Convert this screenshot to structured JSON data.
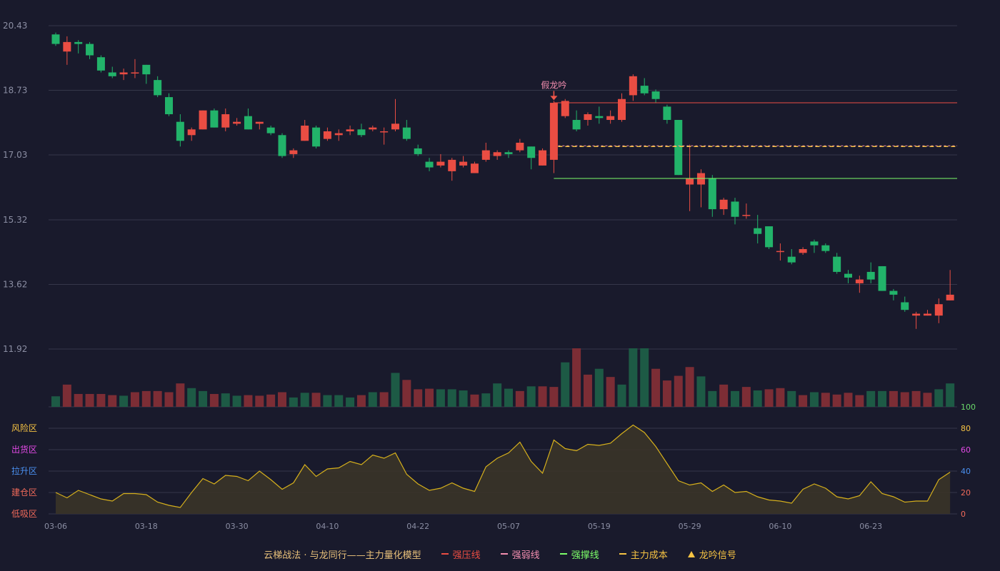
{
  "chart_data": {
    "type": "candlestick",
    "price_axis": {
      "ticks": [
        20.43,
        18.73,
        17.03,
        15.32,
        13.62,
        11.92
      ],
      "range": [
        11.92,
        20.43
      ]
    },
    "x_tick_labels": [
      {
        "i": 0,
        "label": "03-06"
      },
      {
        "i": 8,
        "label": "03-18"
      },
      {
        "i": 16,
        "label": "03-30"
      },
      {
        "i": 24,
        "label": "04-10"
      },
      {
        "i": 32,
        "label": "04-22"
      },
      {
        "i": 40,
        "label": "05-07"
      },
      {
        "i": 48,
        "label": "05-19"
      },
      {
        "i": 56,
        "label": "05-29"
      },
      {
        "i": 64,
        "label": "06-10"
      },
      {
        "i": 72,
        "label": "06-23"
      }
    ],
    "candles": [
      [
        20.2,
        19.95,
        20.25,
        19.9
      ],
      [
        19.75,
        20.0,
        20.15,
        19.4
      ],
      [
        20.0,
        19.95,
        20.05,
        19.7
      ],
      [
        19.95,
        19.65,
        20.0,
        19.55
      ],
      [
        19.6,
        19.25,
        19.65,
        19.2
      ],
      [
        19.2,
        19.1,
        19.35,
        19.05
      ],
      [
        19.15,
        19.2,
        19.3,
        19.0
      ],
      [
        19.2,
        19.2,
        19.55,
        19.05
      ],
      [
        19.4,
        19.15,
        19.4,
        18.9
      ],
      [
        19.0,
        18.6,
        19.1,
        18.55
      ],
      [
        18.55,
        18.1,
        18.65,
        18.05
      ],
      [
        17.9,
        17.4,
        18.1,
        17.25
      ],
      [
        17.55,
        17.7,
        17.75,
        17.4
      ],
      [
        17.7,
        18.2,
        18.2,
        17.7
      ],
      [
        18.2,
        17.75,
        18.25,
        17.75
      ],
      [
        17.75,
        18.1,
        18.25,
        17.65
      ],
      [
        17.85,
        17.9,
        18.0,
        17.8
      ],
      [
        18.05,
        17.7,
        18.25,
        17.7
      ],
      [
        17.85,
        17.9,
        17.9,
        17.7
      ],
      [
        17.75,
        17.6,
        17.8,
        17.55
      ],
      [
        17.55,
        17.0,
        17.6,
        16.95
      ],
      [
        17.05,
        17.15,
        17.2,
        16.95
      ],
      [
        17.4,
        17.8,
        17.95,
        17.4
      ],
      [
        17.75,
        17.25,
        17.8,
        17.2
      ],
      [
        17.45,
        17.65,
        17.75,
        17.4
      ],
      [
        17.55,
        17.6,
        17.7,
        17.4
      ],
      [
        17.65,
        17.7,
        17.8,
        17.55
      ],
      [
        17.7,
        17.55,
        17.85,
        17.5
      ],
      [
        17.7,
        17.75,
        17.8,
        17.65
      ],
      [
        17.65,
        17.65,
        17.75,
        17.3
      ],
      [
        17.7,
        17.85,
        18.5,
        17.65
      ],
      [
        17.75,
        17.45,
        17.95,
        17.4
      ],
      [
        17.2,
        17.05,
        17.3,
        17.0
      ],
      [
        16.85,
        16.7,
        16.95,
        16.6
      ],
      [
        16.75,
        16.85,
        17.05,
        16.7
      ],
      [
        16.6,
        16.9,
        16.95,
        16.35
      ],
      [
        16.75,
        16.85,
        17.0,
        16.7
      ],
      [
        16.55,
        16.8,
        16.85,
        16.55
      ],
      [
        16.9,
        17.15,
        17.35,
        16.85
      ],
      [
        17.0,
        17.1,
        17.15,
        16.9
      ],
      [
        17.1,
        17.05,
        17.15,
        16.95
      ],
      [
        17.15,
        17.35,
        17.45,
        17.1
      ],
      [
        17.25,
        16.95,
        17.25,
        16.65
      ],
      [
        16.75,
        17.15,
        17.2,
        16.75
      ],
      [
        16.9,
        18.4,
        18.45,
        16.55
      ],
      [
        18.05,
        18.45,
        18.5,
        18.0
      ],
      [
        17.95,
        17.7,
        18.2,
        17.65
      ],
      [
        17.95,
        18.1,
        18.15,
        17.8
      ],
      [
        18.05,
        18.0,
        18.3,
        17.85
      ],
      [
        17.95,
        18.05,
        18.2,
        17.85
      ],
      [
        17.95,
        18.5,
        18.65,
        17.9
      ],
      [
        18.6,
        19.1,
        19.15,
        18.45
      ],
      [
        18.85,
        18.65,
        19.05,
        18.6
      ],
      [
        18.7,
        18.5,
        18.75,
        18.4
      ],
      [
        18.3,
        17.95,
        18.35,
        17.85
      ],
      [
        17.95,
        16.5,
        17.95,
        16.5
      ],
      [
        16.25,
        16.4,
        17.3,
        15.55
      ],
      [
        16.25,
        16.55,
        16.65,
        15.65
      ],
      [
        16.4,
        15.6,
        16.5,
        15.4
      ],
      [
        15.6,
        15.85,
        15.9,
        15.45
      ],
      [
        15.8,
        15.4,
        15.9,
        15.2
      ],
      [
        15.45,
        15.45,
        15.75,
        15.35
      ],
      [
        15.1,
        14.95,
        15.45,
        14.7
      ],
      [
        15.15,
        14.6,
        15.15,
        14.55
      ],
      [
        14.5,
        14.5,
        14.7,
        14.25
      ],
      [
        14.35,
        14.2,
        14.55,
        14.15
      ],
      [
        14.45,
        14.55,
        14.6,
        14.4
      ],
      [
        14.75,
        14.65,
        14.8,
        14.45
      ],
      [
        14.65,
        14.5,
        14.7,
        14.45
      ],
      [
        14.35,
        13.95,
        14.45,
        13.9
      ],
      [
        13.9,
        13.8,
        14.0,
        13.65
      ],
      [
        13.65,
        13.75,
        13.85,
        13.4
      ],
      [
        13.95,
        13.75,
        14.2,
        13.65
      ],
      [
        14.1,
        13.45,
        14.1,
        13.45
      ],
      [
        13.45,
        13.35,
        13.5,
        13.2
      ],
      [
        13.15,
        12.95,
        13.3,
        12.9
      ],
      [
        12.8,
        12.85,
        12.9,
        12.45
      ],
      [
        12.8,
        12.85,
        12.95,
        12.8
      ],
      [
        12.8,
        13.1,
        13.25,
        12.6
      ],
      [
        13.2,
        13.35,
        14.0,
        13.2
      ]
    ],
    "volume": [
      [
        "down",
        18
      ],
      [
        "up",
        38
      ],
      [
        "up",
        22
      ],
      [
        "up",
        22
      ],
      [
        "up",
        22
      ],
      [
        "up",
        20
      ],
      [
        "down",
        19
      ],
      [
        "up",
        25
      ],
      [
        "up",
        27
      ],
      [
        "up",
        27
      ],
      [
        "up",
        25
      ],
      [
        "up",
        40
      ],
      [
        "down",
        32
      ],
      [
        "down",
        27
      ],
      [
        "up",
        22
      ],
      [
        "down",
        23
      ],
      [
        "down",
        19
      ],
      [
        "up",
        20
      ],
      [
        "up",
        19
      ],
      [
        "up",
        21
      ],
      [
        "up",
        25
      ],
      [
        "down",
        16
      ],
      [
        "down",
        24
      ],
      [
        "up",
        24
      ],
      [
        "down",
        20
      ],
      [
        "down",
        20
      ],
      [
        "down",
        16
      ],
      [
        "up",
        20
      ],
      [
        "down",
        25
      ],
      [
        "up",
        25
      ],
      [
        "down",
        58
      ],
      [
        "up",
        46
      ],
      [
        "up",
        30
      ],
      [
        "up",
        31
      ],
      [
        "down",
        30
      ],
      [
        "down",
        30
      ],
      [
        "down",
        28
      ],
      [
        "up",
        21
      ],
      [
        "down",
        23
      ],
      [
        "down",
        40
      ],
      [
        "down",
        31
      ],
      [
        "up",
        27
      ],
      [
        "down",
        35
      ],
      [
        "up",
        35
      ],
      [
        "up",
        34
      ],
      [
        "down",
        76
      ],
      [
        "up",
        100
      ],
      [
        "up",
        55
      ],
      [
        "down",
        65
      ],
      [
        "up",
        51
      ],
      [
        "down",
        38
      ],
      [
        "down",
        100
      ],
      [
        "down",
        100
      ],
      [
        "up",
        65
      ],
      [
        "up",
        45
      ],
      [
        "up",
        53
      ],
      [
        "up",
        68
      ],
      [
        "down",
        52
      ],
      [
        "down",
        27
      ],
      [
        "up",
        38
      ],
      [
        "down",
        27
      ],
      [
        "up",
        34
      ],
      [
        "down",
        28
      ],
      [
        "up",
        30
      ],
      [
        "up",
        32
      ],
      [
        "down",
        27
      ],
      [
        "up",
        20
      ],
      [
        "down",
        25
      ],
      [
        "up",
        24
      ],
      [
        "up",
        21
      ],
      [
        "up",
        24
      ],
      [
        "up",
        20
      ],
      [
        "down",
        27
      ],
      [
        "down",
        27
      ],
      [
        "up",
        27
      ],
      [
        "up",
        25
      ],
      [
        "up",
        27
      ],
      [
        "up",
        24
      ],
      [
        "down",
        30
      ],
      [
        "down",
        40
      ]
    ],
    "indicator": {
      "name": "主力量化模型",
      "axis_ticks": [
        0,
        20,
        40,
        60,
        80,
        100
      ],
      "values": [
        20,
        15,
        22,
        18,
        14,
        12,
        19,
        19,
        18,
        11,
        8,
        6,
        20,
        33,
        28,
        36,
        35,
        31,
        40,
        32,
        23,
        29,
        46,
        35,
        42,
        43,
        49,
        46,
        55,
        52,
        57,
        37,
        28,
        22,
        24,
        29,
        24,
        21,
        44,
        52,
        57,
        67,
        49,
        38,
        69,
        61,
        59,
        65,
        64,
        66,
        75,
        83,
        76,
        63,
        47,
        31,
        27,
        29,
        21,
        27,
        20,
        21,
        16,
        13,
        12,
        10,
        23,
        28,
        24,
        16,
        14,
        17,
        30,
        19,
        16,
        11,
        12,
        12,
        32,
        39
      ]
    },
    "zone_labels": [
      {
        "label": "风险区",
        "color": "#f6c343"
      },
      {
        "label": "出货区",
        "color": "#e34ae6"
      },
      {
        "label": "拉升区",
        "color": "#4a90f0"
      },
      {
        "label": "建仓区",
        "color": "#f06a5a"
      },
      {
        "label": "低吸区",
        "color": "#f06a5a"
      }
    ],
    "levels": {
      "strong_pressure": 18.4,
      "main_cost": 17.27,
      "strong_support": 16.41,
      "start_index": 44
    },
    "signal": {
      "index": 44,
      "label": "假龙吟"
    },
    "colors": {
      "up": "#ea4d43",
      "down": "#22b36a",
      "bg": "#191a2c",
      "grid": "#35374a",
      "axis_text": "#8b8ea3",
      "indicator": "#d6b01c"
    }
  },
  "legend": {
    "title": "云梯战法 · 与龙同行——主力量化模型",
    "items": [
      {
        "label": "强压线",
        "color": "#ea4d43",
        "style": "solid"
      },
      {
        "label": "强弱线",
        "color": "#f38eb0",
        "style": "dashed"
      },
      {
        "label": "强撑线",
        "color": "#7dff6a",
        "style": "solid"
      },
      {
        "label": "主力成本",
        "color": "#f6c343",
        "style": "dashed"
      },
      {
        "label": "龙吟信号",
        "color": "#f6c343",
        "style": "triangle"
      }
    ]
  }
}
